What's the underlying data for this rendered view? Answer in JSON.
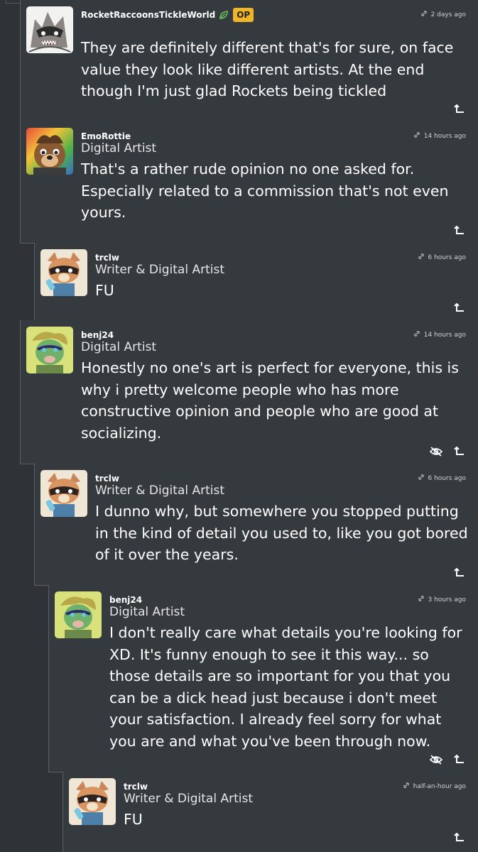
{
  "comments": [
    {
      "username": "RocketRaccoonsTickleWorld",
      "op_badge": "OP",
      "has_leaf": true,
      "title": "",
      "time": "2 days ago",
      "body": "They are definitely different that's for sure, on face value they look like different artists. At the end though I'm just glad Rockets being tickled",
      "icons": [
        "reply-icon"
      ]
    },
    {
      "username": "EmoRottie",
      "title": "Digital Artist",
      "time": "14 hours ago",
      "body": "That's a rather rude opinion no one asked for. Especially related to a commission that's not even yours.",
      "icons": [
        "reply-icon"
      ]
    },
    {
      "username": "trclw",
      "title": "Writer & Digital Artist",
      "time": "6 hours ago",
      "body": "FU",
      "icons": [
        "reply-icon"
      ]
    },
    {
      "username": "benj24",
      "title": "Digital Artist",
      "time": "14 hours ago",
      "body": "Honestly no one's art is perfect for everyone, this is why i pretty welcome people who has more constructive opinion and people who are good at socializing.",
      "icons": [
        "hide-icon",
        "reply-icon"
      ]
    },
    {
      "username": "trclw",
      "title": "Writer & Digital Artist",
      "time": "6 hours ago",
      "body": "I dunno why, but somewhere you stopped putting in the kind of detail you used to, like you got bored of it over the years.",
      "icons": [
        "reply-icon"
      ]
    },
    {
      "username": "benj24",
      "title": "Digital Artist",
      "time": "3 hours ago",
      "body": "I don't really care what details you're looking for XD. It's funny enough to see it this way... so those details are so important for you that you can be a dick head just because i don't meet your satisfaction. I already feel sorry for what you are and what you've been through now.",
      "icons": [
        "hide-icon",
        "reply-icon"
      ]
    },
    {
      "username": "trclw",
      "title": "Writer & Digital Artist",
      "time": "half-an-hour ago",
      "body": "FU",
      "icons": [
        "reply-icon"
      ]
    }
  ],
  "colors": {
    "background": "#2f3337",
    "card": "#353a3f",
    "border": "#5a6066",
    "op_badge": "#f0b429",
    "leaf": "#6bbf59"
  }
}
